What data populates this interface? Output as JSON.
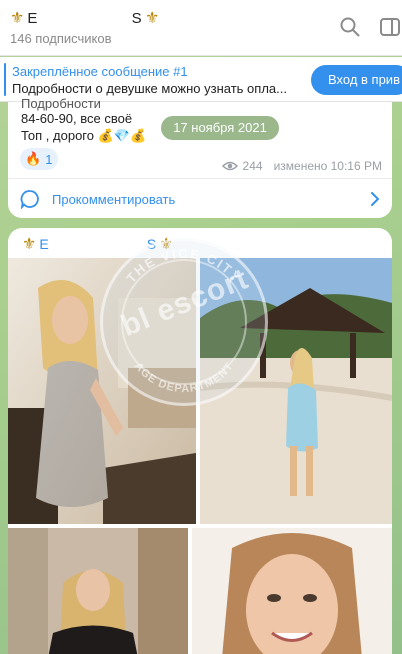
{
  "header": {
    "title_left": "Е",
    "title_right": "S",
    "subscribers": "146 подписчиков",
    "icons": [
      "search-icon",
      "sidebar-toggle-icon"
    ]
  },
  "pinned": {
    "title": "Закреплённое сообщение #1",
    "text": "Подробности о девушке можно узнать опла...",
    "button": "Вход в прив"
  },
  "message1": {
    "line0": "Подробности",
    "line1": "84-60-90, все своё",
    "line2": "Топ , дорого",
    "line2_emoji": "💰💎💰",
    "date": "17 ноября 2021",
    "reaction_emoji": "🔥",
    "reaction_count": "1",
    "views": "244",
    "edited": "изменено 10:16 PM",
    "comments": "Прокомментировать"
  },
  "message2": {
    "author_left": "Е",
    "author_right": "S"
  },
  "watermark": {
    "ring_text": "THE VICE CITY",
    "ring_text2": "AGE DEPARTMENT",
    "text": "bl escort"
  },
  "colors": {
    "accent": "#3390ec",
    "pill": "#7ea864",
    "gold": "#b8860b"
  }
}
